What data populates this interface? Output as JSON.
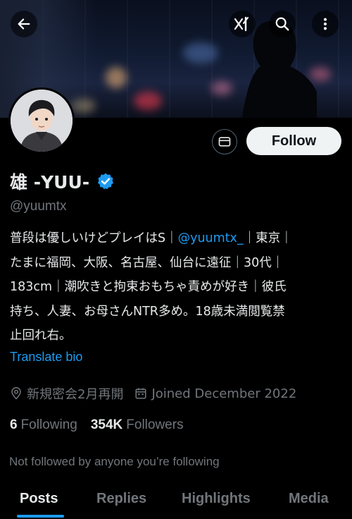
{
  "header": {
    "back_icon": "arrow-left-icon",
    "grok_icon": "grok-icon",
    "search_icon": "search-icon",
    "more_icon": "more-vertical-icon"
  },
  "profile": {
    "name": "雄 -YUU-",
    "verified_icon": "verified-badge-icon",
    "handle": "@yuumtx",
    "bio_lines": [
      {
        "pre": "普段は優しいけどプレイはS｜",
        "link": "@yuumtx_",
        "post": "｜東京｜"
      },
      {
        "text": "たまに福岡、大阪、名古屋、仙台に遠征｜30代｜"
      },
      {
        "text": "183cm｜潮吹きと拘束おもちゃ責めが好き｜彼氏"
      },
      {
        "text": "持ち、人妻、お母さんNTR多め。18歳未満閲覧禁"
      },
      {
        "text": "止回れ右。"
      }
    ],
    "translate_label": "Translate bio",
    "location": "新規密会2月再開",
    "joined": "Joined December 2022",
    "following_count": "6",
    "following_label": "Following",
    "followers_count": "354K",
    "followers_label": "Followers",
    "not_followed_text": "Not followed by anyone you’re following"
  },
  "actions": {
    "message_icon": "mail-icon",
    "follow_label": "Follow"
  },
  "tabs": [
    {
      "label": "Posts",
      "active": true
    },
    {
      "label": "Replies",
      "active": false
    },
    {
      "label": "Highlights",
      "active": false
    },
    {
      "label": "Media",
      "active": false
    }
  ],
  "colors": {
    "background": "#000000",
    "accent": "#1d9bf0",
    "text_primary": "#e7e9ea",
    "text_secondary": "#71767b",
    "follow_bg": "#eff3f4"
  }
}
